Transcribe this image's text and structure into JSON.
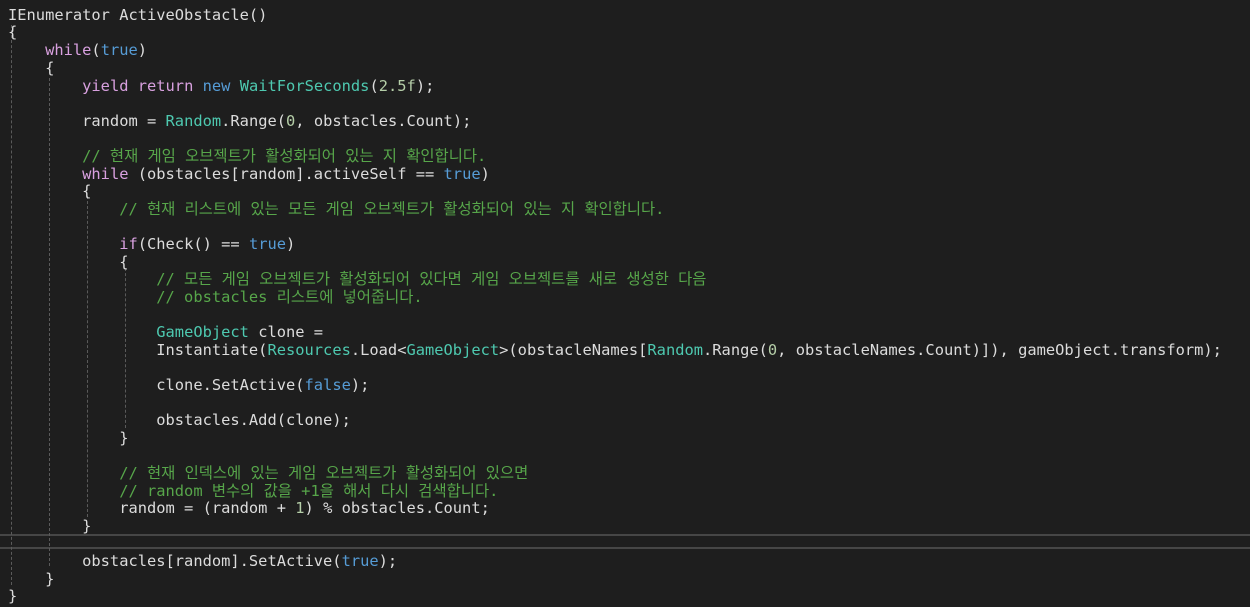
{
  "editor": {
    "colors": {
      "background": "#1e1e1e",
      "plain": "#dcdcdc",
      "keyword": "#569cd6",
      "control": "#d8a0df",
      "type": "#4ec9b0",
      "comment": "#57a64a",
      "number": "#b5cea8"
    },
    "lines": [
      [
        {
          "t": "IEnumerator ActiveObstacle()",
          "c": "pl"
        }
      ],
      [
        {
          "t": "{",
          "c": "pl"
        }
      ],
      [
        {
          "t": "    ",
          "c": "pl"
        },
        {
          "t": "while",
          "c": "kc"
        },
        {
          "t": "(",
          "c": "pl"
        },
        {
          "t": "true",
          "c": "kw"
        },
        {
          "t": ")",
          "c": "pl"
        }
      ],
      [
        {
          "t": "    {",
          "c": "pl"
        }
      ],
      [
        {
          "t": "        ",
          "c": "pl"
        },
        {
          "t": "yield return",
          "c": "kc"
        },
        {
          "t": " ",
          "c": "pl"
        },
        {
          "t": "new",
          "c": "kw"
        },
        {
          "t": " ",
          "c": "pl"
        },
        {
          "t": "WaitForSeconds",
          "c": "ty"
        },
        {
          "t": "(",
          "c": "pl"
        },
        {
          "t": "2.5f",
          "c": "nu"
        },
        {
          "t": ");",
          "c": "pl"
        }
      ],
      [],
      [
        {
          "t": "        random = ",
          "c": "pl"
        },
        {
          "t": "Random",
          "c": "ty"
        },
        {
          "t": ".Range(",
          "c": "pl"
        },
        {
          "t": "0",
          "c": "nu"
        },
        {
          "t": ", obstacles.Count);",
          "c": "pl"
        }
      ],
      [],
      [
        {
          "t": "        // 현재 게임 오브젝트가 활성화되어 있는 지 확인합니다.",
          "c": "cm"
        }
      ],
      [
        {
          "t": "        ",
          "c": "pl"
        },
        {
          "t": "while",
          "c": "kc"
        },
        {
          "t": " (obstacles[random].activeSelf == ",
          "c": "pl"
        },
        {
          "t": "true",
          "c": "kw"
        },
        {
          "t": ")",
          "c": "pl"
        }
      ],
      [
        {
          "t": "        {",
          "c": "pl"
        }
      ],
      [
        {
          "t": "            // 현재 리스트에 있는 모든 게임 오브젝트가 활성화되어 있는 지 확인합니다.",
          "c": "cm"
        }
      ],
      [],
      [
        {
          "t": "            ",
          "c": "pl"
        },
        {
          "t": "if",
          "c": "kc"
        },
        {
          "t": "(Check() == ",
          "c": "pl"
        },
        {
          "t": "true",
          "c": "kw"
        },
        {
          "t": ")",
          "c": "pl"
        }
      ],
      [
        {
          "t": "            {",
          "c": "pl"
        }
      ],
      [
        {
          "t": "                // 모든 게임 오브젝트가 활성화되어 있다면 게임 오브젝트를 새로 생성한 다음",
          "c": "cm"
        }
      ],
      [
        {
          "t": "                // obstacles 리스트에 넣어줍니다.",
          "c": "cm"
        }
      ],
      [],
      [
        {
          "t": "                ",
          "c": "pl"
        },
        {
          "t": "GameObject",
          "c": "ty"
        },
        {
          "t": " clone =",
          "c": "pl"
        }
      ],
      [
        {
          "t": "                Instantiate(",
          "c": "pl"
        },
        {
          "t": "Resources",
          "c": "ty"
        },
        {
          "t": ".Load<",
          "c": "pl"
        },
        {
          "t": "GameObject",
          "c": "ty"
        },
        {
          "t": ">(obstacleNames[",
          "c": "pl"
        },
        {
          "t": "Random",
          "c": "ty"
        },
        {
          "t": ".Range(",
          "c": "pl"
        },
        {
          "t": "0",
          "c": "nu"
        },
        {
          "t": ", obstacleNames.Count)]), gameObject.transform);",
          "c": "pl"
        }
      ],
      [],
      [
        {
          "t": "                clone.SetActive(",
          "c": "pl"
        },
        {
          "t": "false",
          "c": "kw"
        },
        {
          "t": ");",
          "c": "pl"
        }
      ],
      [],
      [
        {
          "t": "                obstacles.Add(clone);",
          "c": "pl"
        }
      ],
      [
        {
          "t": "            }",
          "c": "pl"
        }
      ],
      [],
      [
        {
          "t": "            // 현재 인덱스에 있는 게임 오브젝트가 활성화되어 있으면",
          "c": "cm"
        }
      ],
      [
        {
          "t": "            // random 변수의 값을 +1을 해서 다시 검색합니다.",
          "c": "cm"
        }
      ],
      [
        {
          "t": "            random = (random + ",
          "c": "pl"
        },
        {
          "t": "1",
          "c": "nu"
        },
        {
          "t": ") % obstacles.Count;",
          "c": "pl"
        }
      ],
      [
        {
          "t": "        }",
          "c": "pl"
        }
      ],
      [],
      [
        {
          "t": "        obstacles[random].SetActive(",
          "c": "pl"
        },
        {
          "t": "true",
          "c": "kw"
        },
        {
          "t": ");",
          "c": "pl"
        }
      ],
      [
        {
          "t": "    }",
          "c": "pl"
        }
      ],
      [
        {
          "t": "}",
          "c": "pl"
        }
      ]
    ]
  }
}
